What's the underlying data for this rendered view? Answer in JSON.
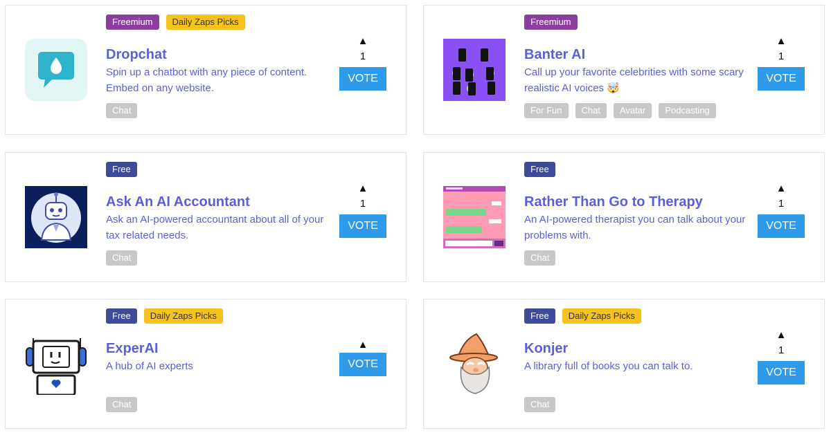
{
  "colors": {
    "freemium": "#8a3f9e",
    "free": "#404a9a",
    "daily_pick": "#f8c21e",
    "title": "#5b5fd6",
    "vote_button": "#2e9bea",
    "tag": "#c8c8c8"
  },
  "tools": [
    {
      "name": "Dropchat",
      "pricing": "Freemium",
      "pick": "Daily Zaps Picks",
      "description": "Spin up a chatbot with any piece of content. Embed on any website.",
      "tags": [
        "Chat"
      ],
      "votes": "1",
      "vote_arrow": "▲",
      "vote_label": "VOTE",
      "image": "chat-bubble-drop-icon"
    },
    {
      "name": "Banter AI",
      "pricing": "Freemium",
      "description": "Call up your favorite celebrities with some scary realistic AI voices 🤯",
      "tags": [
        "For Fun",
        "Chat",
        "Avatar",
        "Podcasting"
      ],
      "votes": "1",
      "vote_arrow": "▲",
      "vote_label": "VOTE",
      "image": "phone-screens-thumbnail"
    },
    {
      "name": "Ask An AI Accountant",
      "pricing": "Free",
      "description": "Ask an AI-powered accountant about all of your tax related needs.",
      "tags": [
        "Chat"
      ],
      "votes": "1",
      "vote_arrow": "▲",
      "vote_label": "VOTE",
      "image": "robot-avatar-icon"
    },
    {
      "name": "Rather Than Go to Therapy",
      "pricing": "Free",
      "description": "An AI-powered therapist you can talk about your problems with.",
      "tags": [
        "Chat"
      ],
      "votes": "1",
      "vote_arrow": "▲",
      "vote_label": "VOTE",
      "image": "chat-window-thumbnail"
    },
    {
      "name": "ExperAI",
      "pricing": "Free",
      "pick": "Daily Zaps Picks",
      "description": "A hub of AI experts",
      "tags": [
        "Chat"
      ],
      "votes": "",
      "vote_arrow": "▲",
      "vote_label": "VOTE",
      "image": "headphone-robot-icon"
    },
    {
      "name": "Konjer",
      "pricing": "Free",
      "pick": "Daily Zaps Picks",
      "description": "A library full of books you can talk to.",
      "tags": [
        "Chat"
      ],
      "votes": "1",
      "vote_arrow": "▲",
      "vote_label": "VOTE",
      "image": "wizard-icon"
    }
  ]
}
